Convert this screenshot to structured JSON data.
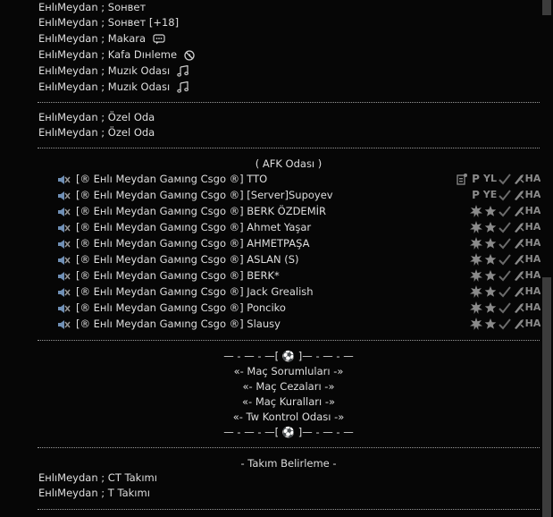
{
  "top_channels": [
    {
      "label": "EнlıMeydan ; Sонвет",
      "icon": ""
    },
    {
      "label": "EнlıMeydan ; Sонвет [+18]",
      "icon": ""
    },
    {
      "label": "EнlıMeydan ; Makara",
      "icon": "speech-bubble-icon"
    },
    {
      "label": "EнlıMeydan ; Kafa Dıнleme",
      "icon": "no-sound-icon"
    },
    {
      "label": "EнlıMeydan ; Muzık Odası",
      "icon": "music-note-icon"
    },
    {
      "label": "EнlıMeydan ; Muzık Odası",
      "icon": "music-note-icon"
    }
  ],
  "private_channels": [
    {
      "label": "EнlıMeydan ; Özel Oda"
    },
    {
      "label": "EнlıMeydan ; Özel Oda"
    }
  ],
  "afk": {
    "title": "( AFK Odası )",
    "users": [
      {
        "name": "[® Eнlı Meydan Gaмıng Csgo ®] TTO"
      },
      {
        "name": "[® Eнlı Meydan Gaмıng Csgo ®] [Server]Supoyev"
      },
      {
        "name": "[® Eнlı Meydan Gaмıng Csgo ®] BERK ÖZDEMİR"
      },
      {
        "name": "[® Eнlı Meydan Gaмıng Csgo ®] Ahmet Yaşar"
      },
      {
        "name": "[® Eнlı Meydan Gaмıng Csgo ®] AHMETPAŞA"
      },
      {
        "name": "[® Eнlı Meydan Gaмıng Csgo ®] ASLAN (S)"
      },
      {
        "name": "[® Eнlı Meydan Gaмıng Csgo ®] BERK*"
      },
      {
        "name": "[® Eнlı Meydan Gaмıng Csgo ®] Jack Grealish"
      },
      {
        "name": "[® Eнlı Meydan Gaмıng Csgo ®] Ponciko"
      },
      {
        "name": "[® Eнlı Meydan Gaмıng Csgo ®] Slausy"
      }
    ],
    "badge_sets": [
      [
        "doc-icon",
        "P",
        "YL",
        "check",
        "knife",
        "HA"
      ],
      [
        "",
        "P",
        "YE",
        "check",
        "knife",
        "HA"
      ],
      [
        "burst",
        "star",
        "check",
        "knife",
        "HA"
      ]
    ]
  },
  "match_section": {
    "top_divider": "— - — - —[ ⚽ ]— - — - —",
    "lines": [
      "«- Maç Sorumluları -»",
      "«- Maç Cezaları -»",
      "«- Maç Kuralları -»",
      "«- Tw Kontrol Odası -»"
    ],
    "bottom_divider": "— - — - —[ ⚽ ]— - — - —"
  },
  "team_section": {
    "title": "- Takım Belirleme -",
    "channels": [
      {
        "label": "EнlıMeydan ; CT Takımı"
      },
      {
        "label": "EнlıMeydan ; T Takımı"
      }
    ]
  },
  "colors": {
    "background": "#060606",
    "text": "#dedede",
    "badge": "#8a8a8a",
    "scroll_thumb": "#3c3c3c"
  }
}
